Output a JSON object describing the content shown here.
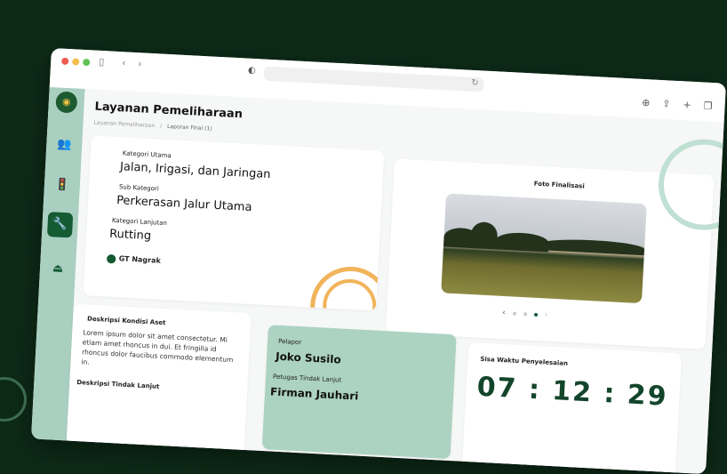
{
  "page_title": "Layanan Pemeliharaan",
  "breadcrumb": [
    "Layanan Pemeliharaan",
    "Laporan Final (1)"
  ],
  "info": {
    "kategori_utama_label": "Kategori Utama",
    "kategori_utama": "Jalan, Irigasi, dan Jaringan",
    "sub_kategori_label": "Sub Kategori",
    "sub_kategori": "Perkerasan Jalur Utama",
    "kategori_lanjutan_label": "Kategori Lanjutan",
    "kategori_lanjutan": "Rutting",
    "location": "GT Nagrak"
  },
  "photo": {
    "title": "Foto Finalisasi",
    "pages": 4,
    "active_index": 3
  },
  "deskripsi": {
    "kondisi_label": "Deskripsi Kondisi Aset",
    "kondisi_text": "Lorem ipsum dolor sit amet consectetur. Mi etiam amet rhoncus in dui. Et fringilla id rhoncus dolor faucibus commodo elementum in.",
    "tindak_label": "Deskripsi Tindak Lanjut"
  },
  "people": {
    "pelapor_label": "Pelapor",
    "pelapor": "Joko Susilo",
    "petugas_label": "Petugas Tindak Lanjut",
    "petugas": "Firman Jauhari"
  },
  "timer": {
    "label": "Sisa Waktu Penyelesaian",
    "value": "07 : 12 : 29"
  },
  "colors": {
    "brand": "#145a33",
    "sidebar": "#a9cfc0",
    "accent_orange": "#f1b45a",
    "accent_mint": "#bfe0d2",
    "bg": "#0d2a17"
  },
  "icons": [
    "sidebar-toggle-icon",
    "back-icon",
    "forward-icon",
    "shield-icon",
    "reload-icon",
    "download-icon",
    "share-icon",
    "plus-icon",
    "tabs-icon",
    "users-icon",
    "traffic-light-icon",
    "tools-icon",
    "stamp-icon",
    "location-pin-icon"
  ]
}
